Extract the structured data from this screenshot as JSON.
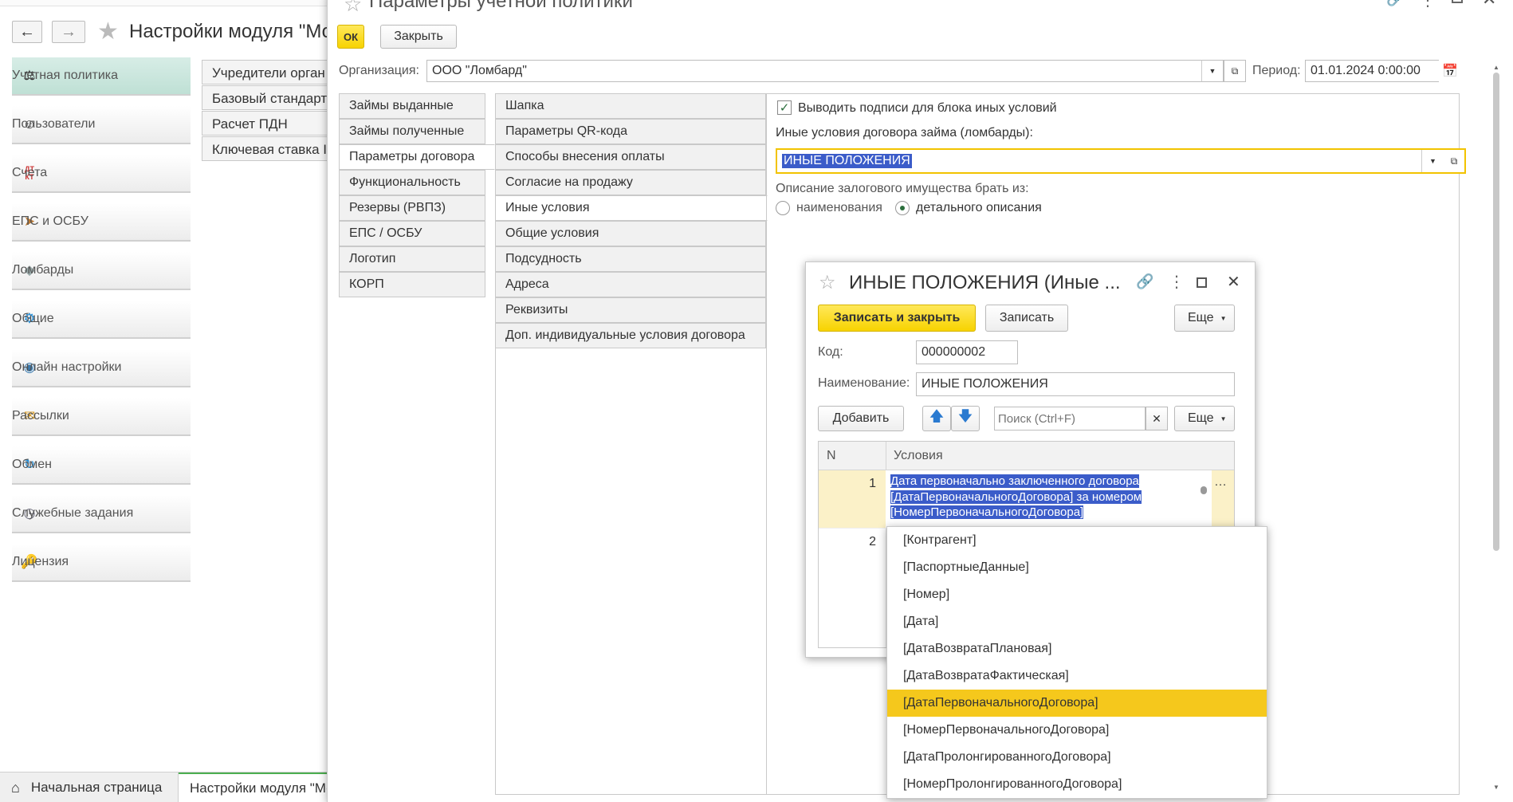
{
  "app": {
    "window_title": "Настройки модуля \"Мо",
    "star": "☆"
  },
  "sidebar": {
    "items": [
      {
        "label": "Учетная политика",
        "icon": "scales-icon"
      },
      {
        "label": "Пользователи",
        "icon": "user-icon"
      },
      {
        "label": "Счета",
        "icon": "dt-kt-icon"
      },
      {
        "label": "ЕПС и ОСБУ",
        "icon": "signpost-icon"
      },
      {
        "label": "Ломбарды",
        "icon": "diamond-icon"
      },
      {
        "label": "Общие",
        "icon": "gear-icon"
      },
      {
        "label": "Онлайн настройки",
        "icon": "globe-icon"
      },
      {
        "label": "Рассылки",
        "icon": "envelope-icon"
      },
      {
        "label": "Обмен",
        "icon": "exchange-icon"
      },
      {
        "label": "Служебные задания",
        "icon": "clock-icon"
      },
      {
        "label": "Лицензия",
        "icon": "key-icon"
      }
    ]
  },
  "section_list": [
    "Учредители орган",
    "Базовый стандарт",
    "Расчет ПДН",
    "Ключевая ставка I"
  ],
  "bottom_tabs": {
    "home": "Начальная страница",
    "current": "Настройки модуля \"Мо"
  },
  "main": {
    "title": "Параметры учетной политики",
    "ok_label": "ОК",
    "close_label": "Закрыть",
    "org_label": "Организация:",
    "org_value": "ООО \"Ломбард\"",
    "period_label": "Период:",
    "period_value": "01.01.2024  0:00:00",
    "left_tabs": [
      "Займы выданные",
      "Займы полученные",
      "Параметры договора",
      "Функциональность",
      "Резервы (РВПЗ)",
      "ЕПС / ОСБУ",
      "Логотип",
      "КОРП"
    ],
    "left_tab_selected": 2,
    "sub_tabs": [
      "Шапка",
      "Параметры QR-кода",
      "Способы внесения оплаты",
      "Согласие на продажу",
      "Иные условия",
      "Общие условия",
      "Подсудность",
      "Адреса",
      "Реквизиты",
      "Доп. индивидуальные условия договора"
    ],
    "sub_tab_selected": 4,
    "checkbox_label": "Выводить подписи для блока иных условий",
    "checkbox_checked": true,
    "other_conditions_label": "Иные условия договора займа (ломбарды):",
    "other_conditions_value": "ИНЫЕ ПОЛОЖЕНИЯ",
    "pledge_label": "Описание залогового имущества брать из:",
    "radio_option1": "наименования",
    "radio_option2": "детального описания",
    "radio_selected": 2
  },
  "dialog": {
    "title": "ИНЫЕ ПОЛОЖЕНИЯ (Иные ...",
    "save_close_label": "Записать и закрыть",
    "save_label": "Записать",
    "more_label": "Еще",
    "code_label": "Код:",
    "code_value": "000000002",
    "name_label": "Наименование:",
    "name_value": "ИНЫЕ ПОЛОЖЕНИЯ",
    "add_label": "Добавить",
    "search_placeholder": "Поиск (Ctrl+F)",
    "more2_label": "Еще",
    "table": {
      "col_n": "N",
      "col_cond": "Условия",
      "rows": [
        {
          "n": "1",
          "text": "Дата первоначально заключенного договора [ДатаПервоначальногоДоговора] за номером [НомерПервоначальногоДоговора]"
        },
        {
          "n": "2",
          "text": ""
        }
      ]
    }
  },
  "dropdown": {
    "items": [
      "[Контрагент]",
      "[ПаспортныеДанные]",
      "[Номер]",
      "[Дата]",
      "[ДатаВозвратаПлановая]",
      "[ДатаВозвратаФактическая]",
      "[ДатаПервоначальногоДоговора]",
      "[НомерПервоначальногоДоговора]",
      "[ДатаПролонгированногоДоговора]",
      "[НомерПролонгированногоДоговора]"
    ],
    "highlighted": 6
  },
  "colors": {
    "accent_yellow": "#f7d300",
    "selection_blue": "#3b5cc9",
    "highlight": "#f5c81c",
    "sidebar_active": "#c8e6dc"
  }
}
